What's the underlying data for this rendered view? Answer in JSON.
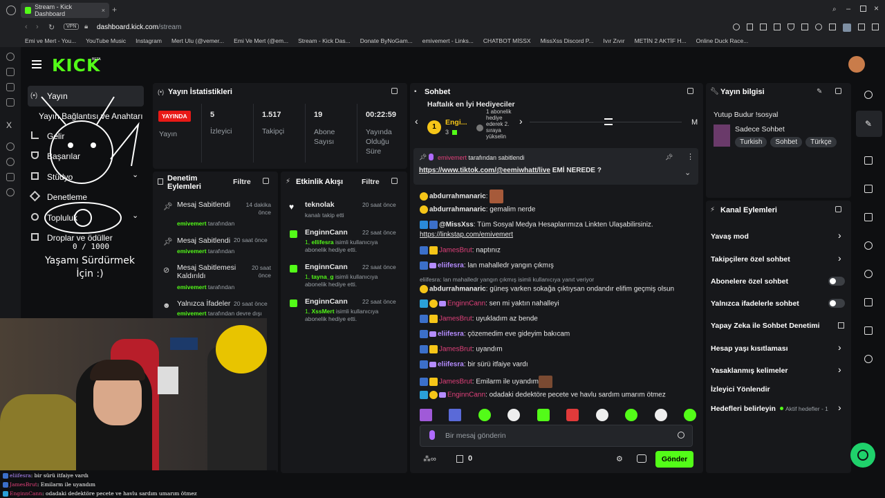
{
  "browser": {
    "tab_title": "Stream - Kick Dashboard",
    "url_host": "dashboard.kick.com",
    "url_path": "/stream",
    "vpn": "VPN"
  },
  "bookmarks": [
    "Emi ve Mert - You...",
    "YouTube Music",
    "Instagram",
    "Mert Ulu (@vemer...",
    "Emi Ve Mert (@em...",
    "Stream - Kick Das...",
    "Donate ByNoGam...",
    "emivemert - Links...",
    "CHATBOT MİSSX",
    "MissXss Discord P...",
    "Ivır Zıvır",
    "METİN 2 AKTİF H...",
    "Online Duck Race..."
  ],
  "logo": "KICK",
  "logo_beta": "BETA",
  "nav": [
    "Yayın",
    "Yayın Bağlantısı ve Anahtarı",
    "Gelir",
    "Başarılar",
    "Stüdyo",
    "Denetleme",
    "Topluluk",
    "Droplar ve ödüller"
  ],
  "overlay_goal": {
    "count": "0 / 1000",
    "text": "Yaşamı Sürdürmek İçin :)"
  },
  "stats": {
    "title": "Yayın İstatistikleri",
    "live_badge": "YAYINDA",
    "live_label": "Yayın",
    "items": [
      {
        "value": "5",
        "label": "İzleyici"
      },
      {
        "value": "1.517",
        "label": "Takipçi"
      },
      {
        "value": "19",
        "label": "Abone Sayısı"
      },
      {
        "value": "00:22:59",
        "label": "Yayında Olduğu Süre"
      }
    ]
  },
  "moderation": {
    "title": "Denetim Eylemleri",
    "filter": "Filtre",
    "items": [
      {
        "title": "Mesaj Sabitlendi",
        "time": "14 dakika önce",
        "by": "emivemert",
        "suffix": "tarafından"
      },
      {
        "title": "Mesaj Sabitlendi",
        "time": "20 saat önce",
        "by": "emivemert",
        "suffix": "tarafından"
      },
      {
        "title": "Mesaj Sabitlemesi Kaldırıldı",
        "time": "20 saat önce",
        "by": "emivemert",
        "suffix": "tarafından"
      },
      {
        "title": "Yalnızca İfadeler",
        "time": "20 saat önce",
        "by": "emivemert",
        "suffix": "tarafından devre dışı"
      }
    ]
  },
  "activity": {
    "title": "Etkinlik Akışı",
    "filter": "Filtre",
    "items": [
      {
        "user": "teknolak",
        "time": "20 saat önce",
        "detail": "kanalı takip etti",
        "count": "",
        "target": ""
      },
      {
        "user": "EnginnCann",
        "time": "22 saat önce",
        "count": "1,",
        "target": "ellifesra",
        "detail": "isimli kullanıcıya abonelik hediye etti."
      },
      {
        "user": "EnginnCann",
        "time": "22 saat önce",
        "count": "1,",
        "target": "tayna_g",
        "detail": "isimli kullanıcıya abonelik hediye etti."
      },
      {
        "user": "EnginnCann",
        "time": "22 saat önce",
        "count": "1,",
        "target": "XssMert",
        "detail": "isimli kullanıcıya abonelik hediye etti."
      }
    ]
  },
  "chat": {
    "title": "Sohbet",
    "gifters_title": "Haftalık en İyi Hediyeciler",
    "gifter_name": "Engi...",
    "gifter_count": "3",
    "gift_promo": "1 abonelik hediye ederek 2. sıraya yükselin",
    "m_label": "M",
    "pinned": {
      "by": "emivemert",
      "by_suffix": "tarafından sabitlendi",
      "link": "https://www.tiktok.com/@eemiwhatt/live",
      "text": "EMİ NEREDE ?"
    },
    "messages": [
      {
        "user": "abdurrahmanaric",
        "color": "#f5d742",
        "text": ": "
      },
      {
        "user": "abdurrahmanaric",
        "color": "#f5d742",
        "text": ": gemalim nerde"
      },
      {
        "user": "@MissXss",
        "color": "#6fa8ff",
        "text": ": Tüm Sosyal Medya Hesaplarımıza Linkten Ulaşabilirsiniz."
      },
      {
        "user": "",
        "color": "#ffffff",
        "text": "https://linkstap.com/emivemert"
      },
      {
        "user": "JamesBrut",
        "color": "#e0407a",
        "text": ": naptınız"
      },
      {
        "user": "eliifesra",
        "color": "#b58cff",
        "text": ": lan mahalledr yangın çıkmış"
      },
      {
        "user": "",
        "color": "#9aa0a6",
        "text": "eliifesra: lan mahalledr yangın çıkmış isimli kullanıcıya yanıt veriyor"
      },
      {
        "user": "abdurrahmanaric",
        "color": "#f5d742",
        "text": ": güneş varken sokağa çıktıysan ondandır elifim geçmiş olsun"
      },
      {
        "user": "EnginnCann",
        "color": "#e0407a",
        "text": ": sen mi yaktın nahalleyi"
      },
      {
        "user": "JamesBrut",
        "color": "#e0407a",
        "text": ": uyukladım az bende"
      },
      {
        "user": "eliifesra",
        "color": "#b58cff",
        "text": ": çözemedim eve gideyim bakıcam"
      },
      {
        "user": "JamesBrut",
        "color": "#e0407a",
        "text": ": uyandım"
      },
      {
        "user": "eliifesra",
        "color": "#b58cff",
        "text": ": bir sürü itfaiye vardı"
      },
      {
        "user": "JamesBrut",
        "color": "#e0407a",
        "text": ": Emilarm ile uyandım"
      },
      {
        "user": "EnginnCann",
        "color": "#e0407a",
        "text": ": odadaki dedektöre pecete ve havlu sardım umarım ötmez"
      }
    ],
    "input_placeholder": "Bir mesaj gönderin",
    "points": "0",
    "send_label": "Gönder"
  },
  "stream_info": {
    "title": "Yayın bilgisi",
    "stream_title": "Yutup Budur !sosyal",
    "category": "Sadece Sohbet",
    "tags": [
      "Turkish",
      "Sohbet",
      "Türkçe"
    ]
  },
  "channel_actions": {
    "title": "Kanal Eylemleri",
    "items": [
      {
        "label": "Yavaş mod",
        "control": "chevron"
      },
      {
        "label": "Takipçilere özel sohbet",
        "control": "chevron"
      },
      {
        "label": "Abonelere özel sohbet",
        "control": "toggle"
      },
      {
        "label": "Yalnızca ifadelerle sohbet",
        "control": "toggle"
      },
      {
        "label": "Yapay Zeka ile Sohbet Denetimi",
        "control": "external"
      },
      {
        "label": "Hesap yaşı kısıtlaması",
        "control": "chevron"
      },
      {
        "label": "Yasaklanmış kelimeler",
        "control": "chevron"
      },
      {
        "label": "İzleyici Yönlendir",
        "control": "none"
      },
      {
        "label": "Hedefleri belirleyin",
        "control": "chevron",
        "extra": "Aktif hedefler - 1"
      }
    ]
  },
  "overlay_chat": [
    {
      "user": "eliifesra",
      "text": ": bir sürü itfaiye vardı"
    },
    {
      "user": "JamesBrut",
      "text": ": Emilarm ile uyandım"
    },
    {
      "user": "EnginnCann",
      "text": ": odadaki dedektöre pecete ve havlu sardım umarım ötmez"
    }
  ],
  "colors": {
    "brand": "#53fc18",
    "live": "#e91916",
    "panel": "#17181b",
    "background": "#0e0f11"
  }
}
